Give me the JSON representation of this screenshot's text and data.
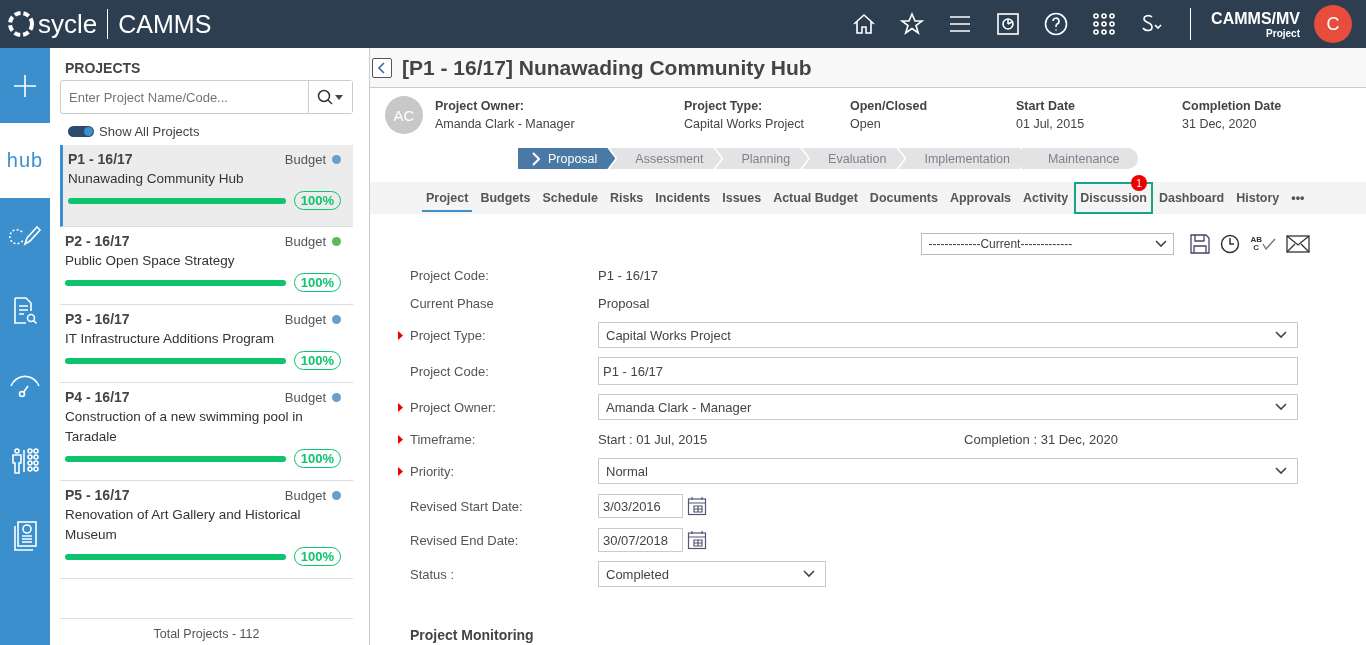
{
  "header": {
    "logo_text": "sycle",
    "app_name": "CAMMS",
    "user_name": "CAMMS/MV",
    "user_role": "Project",
    "avatar_initial": "C"
  },
  "rail": [
    {
      "kind": "add",
      "selected": false
    },
    {
      "kind": "hub",
      "label": "hub",
      "selected": true
    },
    {
      "kind": "edit",
      "selected": false
    },
    {
      "kind": "report",
      "selected": false
    },
    {
      "kind": "gauge",
      "selected": false
    },
    {
      "kind": "people",
      "selected": false
    },
    {
      "kind": "document",
      "selected": false
    }
  ],
  "projects": {
    "title": "PROJECTS",
    "search": {
      "placeholder": "Enter Project Name/Code..."
    },
    "toggle": {
      "label": "Show All Projects",
      "on": true
    },
    "items": [
      {
        "code": "P1 - 16/17",
        "name": "Nunawading Community Hub",
        "tag": "Budget",
        "color": "#6a9fcb",
        "level": 1,
        "reading": "100%",
        "selected": true
      },
      {
        "code": "P2 - 16/17",
        "name": "Public Open Space Strategy",
        "tag": "Budget",
        "color": "#5cb85c",
        "level": 1,
        "reading": "100%",
        "selected": false
      },
      {
        "code": "P3 - 16/17",
        "name": "IT Infrastructure Additions Program",
        "tag": "Budget",
        "color": "#6a9fcb",
        "level": 1,
        "reading": "100%",
        "selected": false
      },
      {
        "code": "P4 - 16/17",
        "name": "Construction of a new swimming pool in Taradale",
        "tag": "Budget",
        "color": "#6a9fcb",
        "level": 1,
        "reading": "100%",
        "selected": false
      },
      {
        "code": "P5 - 16/17",
        "name": "Renovation of Art Gallery and Historical Museum",
        "tag": "Budget",
        "color": "#6a9fcb",
        "level": 1,
        "reading": "100%",
        "selected": false
      }
    ],
    "total": "Total Projects - 112"
  },
  "main": {
    "title": "[P1 - 16/17] Nunawading Community Hub",
    "owner_initials": "AC",
    "summary": [
      {
        "label": "Project Owner:",
        "value": "Amanda Clark - Manager"
      },
      {
        "label": "Project Type:",
        "value": "Capital Works Project"
      },
      {
        "label": "Open/Closed",
        "value": "Open"
      },
      {
        "label": "Start Date",
        "value": "01 Jul, 2015"
      },
      {
        "label": "Completion Date",
        "value": "31 Dec, 2020"
      }
    ],
    "phases": [
      {
        "label": "Proposal",
        "selected": true
      },
      {
        "label": "Assessment",
        "selected": false
      },
      {
        "label": "Planning",
        "selected": false
      },
      {
        "label": "Evaluation",
        "selected": false
      },
      {
        "label": "Implementation",
        "selected": false
      },
      {
        "label": "Maintenance",
        "selected": false
      }
    ],
    "tabs": [
      {
        "label": "Project",
        "selected": true,
        "highlighted": false
      },
      {
        "label": "Budgets",
        "selected": false,
        "highlighted": false
      },
      {
        "label": "Schedule",
        "selected": false,
        "highlighted": false
      },
      {
        "label": "Risks",
        "selected": false,
        "highlighted": false
      },
      {
        "label": "Incidents",
        "selected": false,
        "highlighted": false
      },
      {
        "label": "Issues",
        "selected": false,
        "highlighted": false
      },
      {
        "label": "Actual Budget",
        "selected": false,
        "highlighted": false
      },
      {
        "label": "Documents",
        "selected": false,
        "highlighted": false
      },
      {
        "label": "Approvals",
        "selected": false,
        "highlighted": false
      },
      {
        "label": "Activity",
        "selected": false,
        "highlighted": false
      },
      {
        "label": "Discussion",
        "selected": false,
        "highlighted": true,
        "badge": "1"
      },
      {
        "label": "Dashboard",
        "selected": false,
        "highlighted": false
      },
      {
        "label": "History",
        "selected": false,
        "highlighted": false
      },
      {
        "label": "•••",
        "selected": false,
        "highlighted": false
      }
    ],
    "version_select": "-------------Current-------------",
    "spellcheck_label": [
      "AB",
      "C"
    ],
    "form": [
      {
        "kind": "text",
        "label": "Project Code:",
        "required": false,
        "value": "P1 - 16/17"
      },
      {
        "kind": "text",
        "label": "Current Phase",
        "required": false,
        "value": "Proposal"
      },
      {
        "kind": "select",
        "label": "Project Type:",
        "required": true,
        "value": "Capital Works Project"
      },
      {
        "kind": "input",
        "label": "Project Code:",
        "required": false,
        "value": "P1 - 16/17"
      },
      {
        "kind": "select",
        "label": "Project Owner:",
        "required": true,
        "value": "Amanda Clark - Manager"
      },
      {
        "kind": "timeframe",
        "label": "Timeframe:",
        "required": true,
        "start": "Start : 01 Jul, 2015",
        "end": "Completion : 31 Dec, 2020"
      },
      {
        "kind": "select",
        "label": "Priority:",
        "required": true,
        "value": "Normal"
      },
      {
        "kind": "date",
        "label": "Revised Start Date:",
        "required": false,
        "value": "3/03/2016"
      },
      {
        "kind": "date",
        "label": "Revised End Date:",
        "required": false,
        "value": "30/07/2018"
      },
      {
        "kind": "short-select",
        "label": "Status :",
        "required": false,
        "value": "Completed"
      }
    ],
    "section_heading": "Project Monitoring"
  }
}
